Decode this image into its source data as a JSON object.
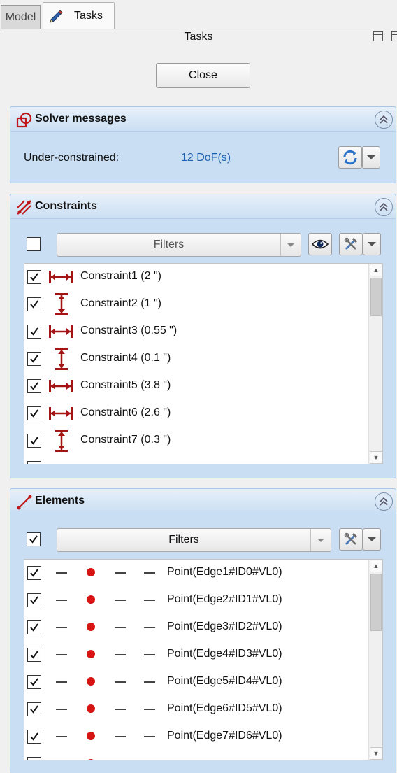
{
  "tabs": [
    {
      "label": "Model",
      "active": false
    },
    {
      "label": "Tasks",
      "active": true
    }
  ],
  "panel": {
    "title": "Tasks",
    "close_label": "Close"
  },
  "solver": {
    "title": "Solver messages",
    "status_label": "Under-constrained:",
    "dof_link": "12 DoF(s)"
  },
  "constraints": {
    "title": "Constraints",
    "filters_label": "Filters",
    "items": [
      {
        "label": "Constraint1 (2 \")",
        "type": "horizontal",
        "checked": true
      },
      {
        "label": "Constraint2 (1 \")",
        "type": "vertical",
        "checked": true
      },
      {
        "label": "Constraint3 (0.55 \")",
        "type": "horizontal",
        "checked": true
      },
      {
        "label": "Constraint4 (0.1 \")",
        "type": "vertical",
        "checked": true
      },
      {
        "label": "Constraint5 (3.8 \")",
        "type": "horizontal",
        "checked": true
      },
      {
        "label": "Constraint6 (2.6 \")",
        "type": "horizontal",
        "checked": true
      },
      {
        "label": "Constraint7 (0.3 \")",
        "type": "vertical",
        "checked": true
      }
    ]
  },
  "elements": {
    "title": "Elements",
    "filters_label": "Filters",
    "items": [
      {
        "label": "Point(Edge1#ID0#VL0)",
        "checked": true
      },
      {
        "label": "Point(Edge2#ID1#VL0)",
        "checked": true
      },
      {
        "label": "Point(Edge3#ID2#VL0)",
        "checked": true
      },
      {
        "label": "Point(Edge4#ID3#VL0)",
        "checked": true
      },
      {
        "label": "Point(Edge5#ID4#VL0)",
        "checked": true
      },
      {
        "label": "Point(Edge6#ID5#VL0)",
        "checked": true
      },
      {
        "label": "Point(Edge7#ID6#VL0)",
        "checked": true
      }
    ]
  },
  "colors": {
    "accent_red": "#a31515",
    "point_red": "#d71414",
    "link_blue": "#1d5fb0",
    "taskbox_blue": "#c9def3"
  },
  "icons": [
    "pencil-icon",
    "solver-icon",
    "constraints-icon",
    "elements-icon",
    "refresh-icon",
    "eye-icon",
    "settings-tools-icon",
    "collapse-icon",
    "horizontal-dimension-icon",
    "vertical-dimension-icon",
    "point-icon"
  ]
}
